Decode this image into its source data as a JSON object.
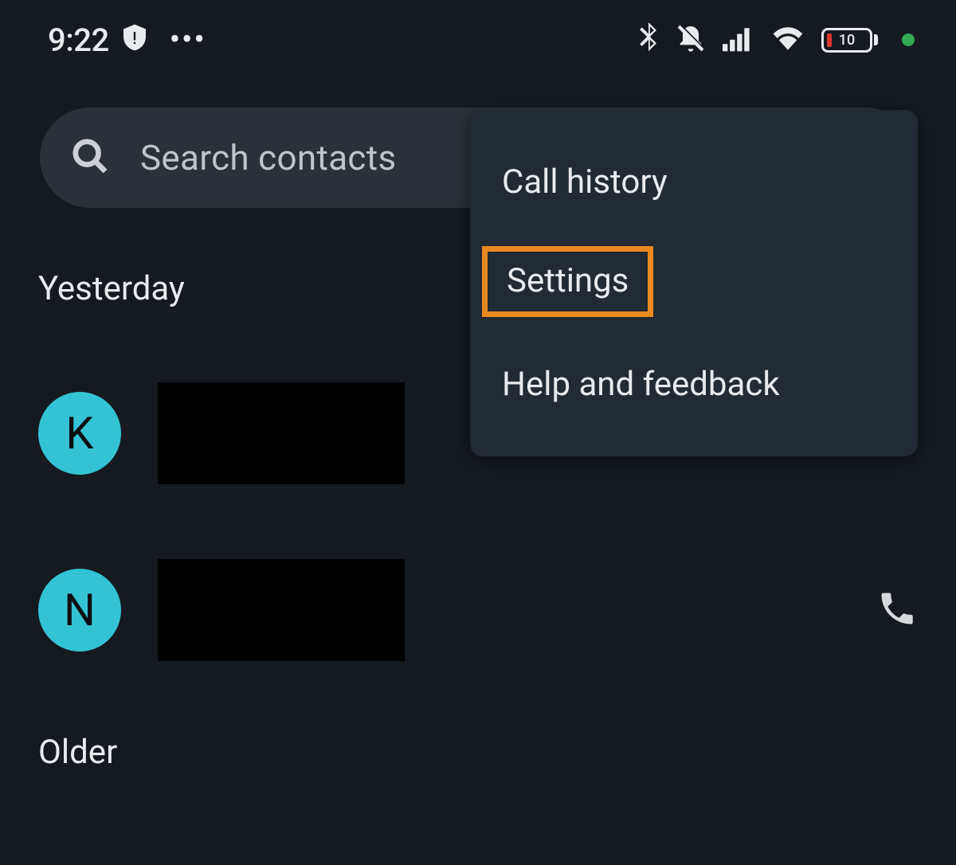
{
  "status": {
    "time": "9:22",
    "battery_text": "10"
  },
  "search": {
    "placeholder": "Search contacts"
  },
  "sections": {
    "yesterday": "Yesterday",
    "older": "Older"
  },
  "contacts": [
    {
      "initial": "K"
    },
    {
      "initial": "N"
    }
  ],
  "menu": {
    "call_history": "Call history",
    "settings": "Settings",
    "help": "Help and feedback"
  }
}
